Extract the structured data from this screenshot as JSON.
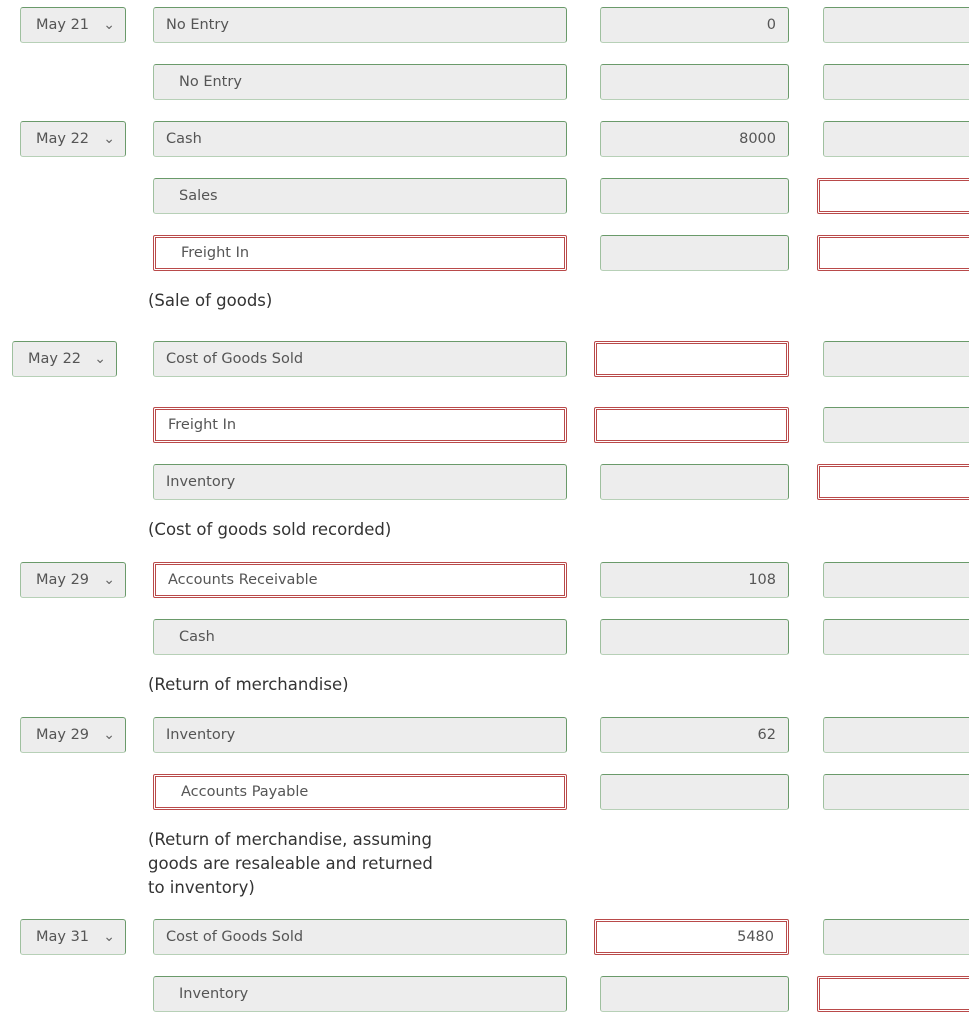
{
  "journal": {
    "entries": [
      {
        "date": "May 21",
        "lines": [
          {
            "account": "No Entry",
            "debit": "0",
            "credit": ""
          },
          {
            "account": "No Entry",
            "debit": "",
            "credit": ""
          }
        ],
        "note": ""
      },
      {
        "date": "May 22",
        "lines": [
          {
            "account": "Cash",
            "debit": "8000",
            "credit": ""
          },
          {
            "account": "Sales",
            "debit": "",
            "credit": ""
          },
          {
            "account": "Freight In",
            "debit": "",
            "credit": ""
          }
        ],
        "note": "(Sale of goods)"
      },
      {
        "date": "May 22",
        "lines": [
          {
            "account": "Cost of Goods Sold",
            "debit": "",
            "credit": ""
          },
          {
            "account": "Freight In",
            "debit": "",
            "credit": ""
          },
          {
            "account": "Inventory",
            "debit": "",
            "credit": ""
          }
        ],
        "note": "(Cost of goods sold recorded)"
      },
      {
        "date": "May 29",
        "lines": [
          {
            "account": "Accounts Receivable",
            "debit": "108",
            "credit": ""
          },
          {
            "account": "Cash",
            "debit": "",
            "credit": ""
          }
        ],
        "note": "(Return of merchandise)"
      },
      {
        "date": "May 29",
        "lines": [
          {
            "account": "Inventory",
            "debit": "62",
            "credit": ""
          },
          {
            "account": "Accounts Payable",
            "debit": "",
            "credit": ""
          }
        ],
        "note_lines": [
          "(Return of merchandise, assuming",
          "goods are resaleable and returned",
          "to inventory)"
        ]
      },
      {
        "date": "May 31",
        "lines": [
          {
            "account": "Cost of Goods Sold",
            "debit": "5480",
            "credit": ""
          },
          {
            "account": "Inventory",
            "debit": "",
            "credit": ""
          }
        ],
        "note": ""
      }
    ]
  },
  "icons": {
    "dropdown": "chevron-down-icon"
  },
  "colors": {
    "valid_border": "#6a9a6a",
    "error_border": "#b94a4a",
    "field_bg": "#ededed"
  }
}
